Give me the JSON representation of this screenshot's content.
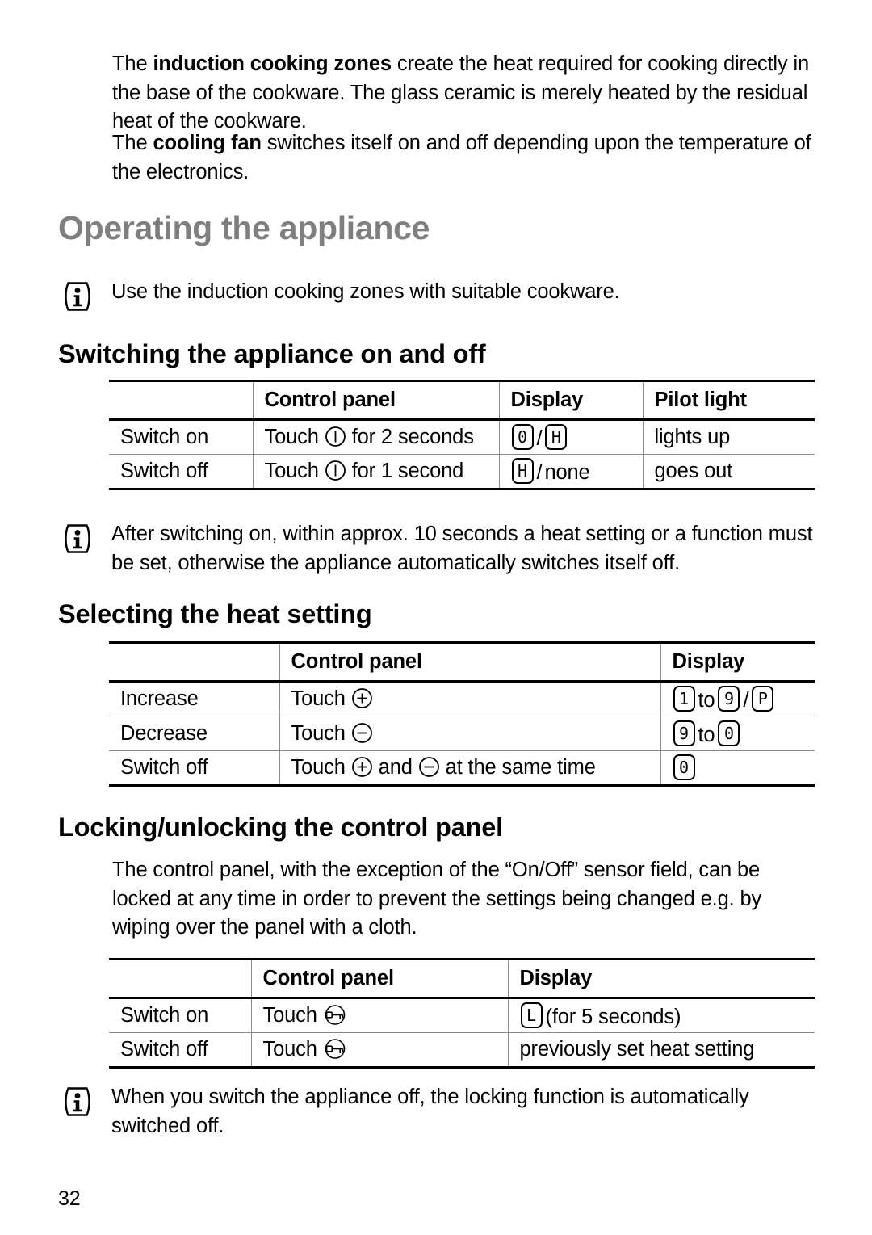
{
  "document": {
    "page_number": "32",
    "heading": "Operating the appliance",
    "heading_color": "#7f7f7f"
  },
  "intro": {
    "para1_lead": "The ",
    "para1_bold": "induction cooking zones",
    "para1_rest": " create the heat required for cooking directly in the base of the cookware. The glass ceramic is merely heated by the residual heat of the cookware.",
    "para2_lead": "The ",
    "para2_bold": "cooling fan",
    "para2_rest": " switches itself on and off depending upon the temperature of the electronics."
  },
  "notes": {
    "note1": "Use the induction cooking zones with suitable cookware.",
    "note2": "After switching on, within approx. 10 seconds a heat setting or a function must be set, otherwise the appliance automatically switches itself off.",
    "note3": "When you switch the appliance off, the locking function is automatically switched off."
  },
  "section_switching": {
    "title": "Switching the appliance on and off",
    "table": {
      "headers": [
        "",
        "Control panel",
        "Display",
        "Pilot light"
      ],
      "rows": [
        {
          "action": "Switch on",
          "control_prefix": "Touch",
          "control_icon": "power-icon",
          "control_suffix": "for 2 seconds",
          "display_segments": [
            "0",
            "H"
          ],
          "display_separator": "/",
          "pilot": "lights up"
        },
        {
          "action": "Switch off",
          "control_prefix": "Touch",
          "control_icon": "power-icon",
          "control_suffix": "for 1 second",
          "display_first_segment": "H",
          "display_separator": "/",
          "display_tail": "none",
          "pilot": "goes out"
        }
      ]
    }
  },
  "section_heat": {
    "title": "Selecting the heat setting",
    "table": {
      "headers": [
        "",
        "Control panel",
        "Display"
      ],
      "rows": [
        {
          "action": "Increase",
          "control_prefix": "Touch",
          "control_icon": "plus-icon",
          "display_from": "1",
          "display_link": "to",
          "display_to": "9",
          "display_separator": "/",
          "display_extra": "P"
        },
        {
          "action": "Decrease",
          "control_prefix": "Touch",
          "control_icon": "minus-icon",
          "display_from": "9",
          "display_link": "to",
          "display_to": "0"
        },
        {
          "action": "Switch off",
          "control_prefix": "Touch",
          "control_icon": "plus-icon",
          "control_mid": "and",
          "control_icon2": "minus-icon",
          "control_suffix": "at the same time",
          "display_from": "0"
        }
      ]
    }
  },
  "section_locking": {
    "title": "Locking/unlocking the control panel",
    "paragraph": "The control panel, with the exception of the “On/Off” sensor field, can be locked at any time in order to prevent the settings being changed e.g. by wiping over the panel with a cloth.",
    "table": {
      "headers": [
        "",
        "Control panel",
        "Display"
      ],
      "rows": [
        {
          "action": "Switch on",
          "control_prefix": "Touch",
          "control_icon": "key-icon",
          "display_segment": "L",
          "display_text": "(for 5 seconds)"
        },
        {
          "action": "Switch off",
          "control_prefix": "Touch",
          "control_icon": "key-icon",
          "display_text": "previously set heat setting"
        }
      ]
    }
  }
}
